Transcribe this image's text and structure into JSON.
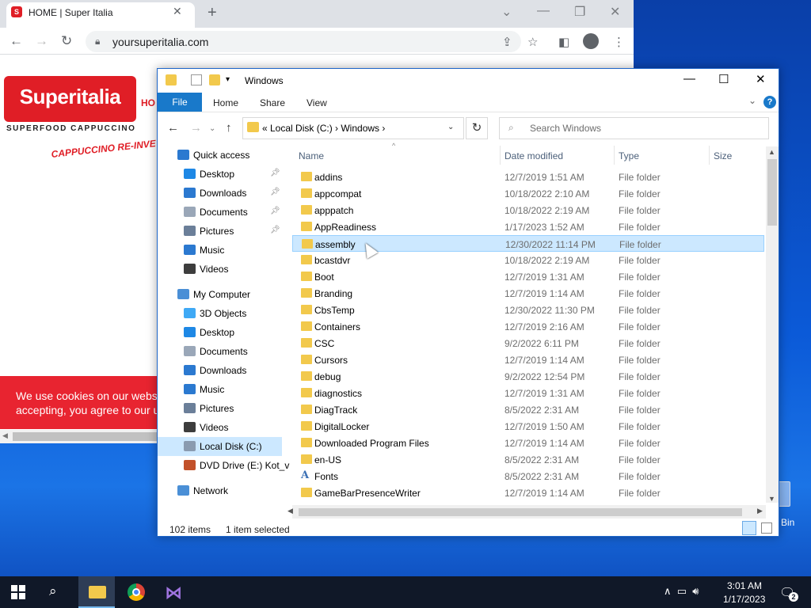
{
  "desktop": {
    "recycle_bin_label": "Bin"
  },
  "browser": {
    "tab_title": "HOME | Super Italia",
    "url": "yoursuperitalia.com",
    "page": {
      "logo_text": "Superitalia",
      "logo_subtitle": "SUPERFOOD CAPPUCCINO",
      "nav_home": "HO",
      "tagline": "CAPPUCCINO RE-INVE",
      "cookie_line1": "We use cookies on our webs",
      "cookie_line2": "accepting, you agree to our u"
    }
  },
  "explorer": {
    "title": "Windows",
    "ribbon_tabs": {
      "file": "File",
      "home": "Home",
      "share": "Share",
      "view": "View"
    },
    "breadcrumb": "«  Local Disk (C:)  ›  Windows  ›",
    "search_placeholder": "Search Windows",
    "columns": {
      "name": "Name",
      "date": "Date modified",
      "type": "Type",
      "size": "Size"
    },
    "nav": [
      {
        "label": "Quick access",
        "icon": "star-icon",
        "color": "#2b79d0",
        "indent": 0,
        "pin": false
      },
      {
        "label": "Desktop",
        "icon": "desktop-icon",
        "color": "#1e88e5",
        "indent": 1,
        "pin": true
      },
      {
        "label": "Downloads",
        "icon": "download-icon",
        "color": "#2b79d0",
        "indent": 1,
        "pin": true
      },
      {
        "label": "Documents",
        "icon": "document-icon",
        "color": "#9aa7b8",
        "indent": 1,
        "pin": true
      },
      {
        "label": "Pictures",
        "icon": "picture-icon",
        "color": "#6b7f99",
        "indent": 1,
        "pin": true
      },
      {
        "label": "Music",
        "icon": "music-icon",
        "color": "#2b79d0",
        "indent": 1,
        "pin": false
      },
      {
        "label": "Videos",
        "icon": "video-icon",
        "color": "#3d3d3d",
        "indent": 1,
        "pin": false
      },
      {
        "label": "My Computer",
        "icon": "computer-icon",
        "color": "#4a8fd6",
        "indent": 0,
        "pin": false
      },
      {
        "label": "3D Objects",
        "icon": "cube-icon",
        "color": "#3fa9f5",
        "indent": 1,
        "pin": false
      },
      {
        "label": "Desktop",
        "icon": "desktop-icon",
        "color": "#1e88e5",
        "indent": 1,
        "pin": false
      },
      {
        "label": "Documents",
        "icon": "document-icon",
        "color": "#9aa7b8",
        "indent": 1,
        "pin": false
      },
      {
        "label": "Downloads",
        "icon": "download-icon",
        "color": "#2b79d0",
        "indent": 1,
        "pin": false
      },
      {
        "label": "Music",
        "icon": "music-icon",
        "color": "#2b79d0",
        "indent": 1,
        "pin": false
      },
      {
        "label": "Pictures",
        "icon": "picture-icon",
        "color": "#6b7f99",
        "indent": 1,
        "pin": false
      },
      {
        "label": "Videos",
        "icon": "video-icon",
        "color": "#3d3d3d",
        "indent": 1,
        "pin": false
      },
      {
        "label": "Local Disk (C:)",
        "icon": "drive-icon",
        "color": "#8a9bb0",
        "indent": 1,
        "pin": false,
        "selected": true
      },
      {
        "label": "DVD Drive (E:) Kot_v",
        "icon": "dvd-icon",
        "color": "#c2512a",
        "indent": 1,
        "pin": false
      },
      {
        "label": "Network",
        "icon": "network-icon",
        "color": "#4a8fd6",
        "indent": 0,
        "pin": false
      }
    ],
    "files": [
      {
        "name": "addins",
        "date": "12/7/2019 1:51 AM",
        "type": "File folder"
      },
      {
        "name": "appcompat",
        "date": "10/18/2022 2:10 AM",
        "type": "File folder"
      },
      {
        "name": "apppatch",
        "date": "10/18/2022 2:19 AM",
        "type": "File folder"
      },
      {
        "name": "AppReadiness",
        "date": "1/17/2023 1:52 AM",
        "type": "File folder"
      },
      {
        "name": "assembly",
        "date": "12/30/2022 11:14 PM",
        "type": "File folder",
        "selected": true
      },
      {
        "name": "bcastdvr",
        "date": "10/18/2022 2:19 AM",
        "type": "File folder"
      },
      {
        "name": "Boot",
        "date": "12/7/2019 1:31 AM",
        "type": "File folder"
      },
      {
        "name": "Branding",
        "date": "12/7/2019 1:14 AM",
        "type": "File folder"
      },
      {
        "name": "CbsTemp",
        "date": "12/30/2022 11:30 PM",
        "type": "File folder"
      },
      {
        "name": "Containers",
        "date": "12/7/2019 2:16 AM",
        "type": "File folder"
      },
      {
        "name": "CSC",
        "date": "9/2/2022 6:11 PM",
        "type": "File folder"
      },
      {
        "name": "Cursors",
        "date": "12/7/2019 1:14 AM",
        "type": "File folder"
      },
      {
        "name": "debug",
        "date": "9/2/2022 12:54 PM",
        "type": "File folder"
      },
      {
        "name": "diagnostics",
        "date": "12/7/2019 1:31 AM",
        "type": "File folder"
      },
      {
        "name": "DiagTrack",
        "date": "8/5/2022 2:31 AM",
        "type": "File folder"
      },
      {
        "name": "DigitalLocker",
        "date": "12/7/2019 1:50 AM",
        "type": "File folder"
      },
      {
        "name": "Downloaded Program Files",
        "date": "12/7/2019 1:14 AM",
        "type": "File folder"
      },
      {
        "name": "en-US",
        "date": "8/5/2022 2:31 AM",
        "type": "File folder"
      },
      {
        "name": "Fonts",
        "date": "8/5/2022 2:31 AM",
        "type": "File folder",
        "icon": "font"
      },
      {
        "name": "GameBarPresenceWriter",
        "date": "12/7/2019 1:14 AM",
        "type": "File folder"
      }
    ],
    "status": {
      "count": "102 items",
      "selected": "1 item selected"
    }
  },
  "taskbar": {
    "time": "3:01 AM",
    "date": "1/17/2023",
    "notifications": "2"
  }
}
